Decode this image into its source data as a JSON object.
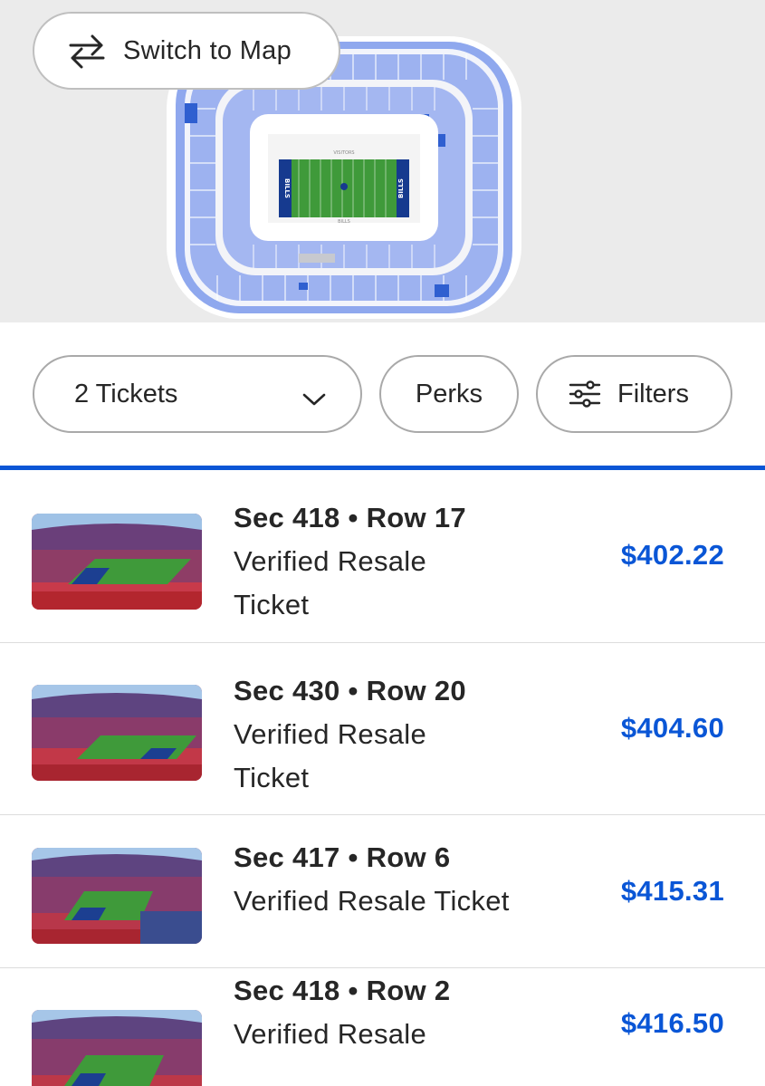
{
  "map": {
    "switch_label": "Switch to Map",
    "switch_icon": "swap-arrows-icon",
    "field_label_top": "VISITORS",
    "field_label_bottom": "BILLS",
    "endzone_left": "BILLS",
    "endzone_right": "BILLS"
  },
  "filters": {
    "tickets_label": "2 Tickets",
    "tickets_icon": "chevron-down-icon",
    "perks_label": "Perks",
    "filters_label": "Filters",
    "filters_icon": "sliders-icon"
  },
  "colors": {
    "accent": "#0a56d6",
    "section_available": "#8fa8ee",
    "section_highlight": "#2f5fd0",
    "field_green": "#3f9a3a",
    "endzone_blue": "#163a8f"
  },
  "listings": [
    {
      "section_row": "Sec 418 • Row 17",
      "ticket_type": "Verified Resale",
      "ticket_type_2": "Ticket",
      "price": "$402.22"
    },
    {
      "section_row": "Sec 430 • Row 20",
      "ticket_type": "Verified Resale",
      "ticket_type_2": "Ticket",
      "price": "$404.60"
    },
    {
      "section_row": "Sec 417 • Row 6",
      "ticket_type": "Verified Resale Ticket",
      "ticket_type_2": "",
      "price": "$415.31"
    },
    {
      "section_row": "Sec 418 • Row 2",
      "ticket_type": "Verified Resale",
      "ticket_type_2": "",
      "price": "$416.50"
    }
  ]
}
